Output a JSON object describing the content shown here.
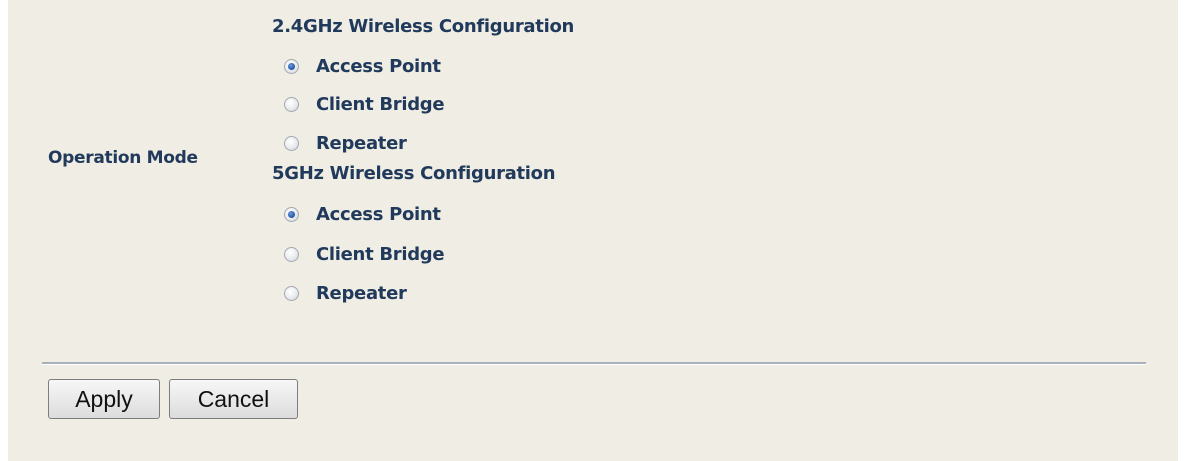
{
  "operation_mode": {
    "label": "Operation Mode"
  },
  "band_24": {
    "title": "2.4GHz Wireless Configuration",
    "options": [
      {
        "label": "Access Point",
        "checked": true
      },
      {
        "label": "Client Bridge",
        "checked": false
      },
      {
        "label": "Repeater",
        "checked": false
      }
    ]
  },
  "band_5": {
    "title": "5GHz Wireless Configuration",
    "options": [
      {
        "label": "Access Point",
        "checked": true
      },
      {
        "label": "Client Bridge",
        "checked": false
      },
      {
        "label": "Repeater",
        "checked": false
      }
    ]
  },
  "buttons": {
    "apply": "Apply",
    "cancel": "Cancel"
  },
  "colors": {
    "panel_background": "#efede4",
    "label_text": "#213a5c",
    "divider": "#a9b1bd"
  }
}
